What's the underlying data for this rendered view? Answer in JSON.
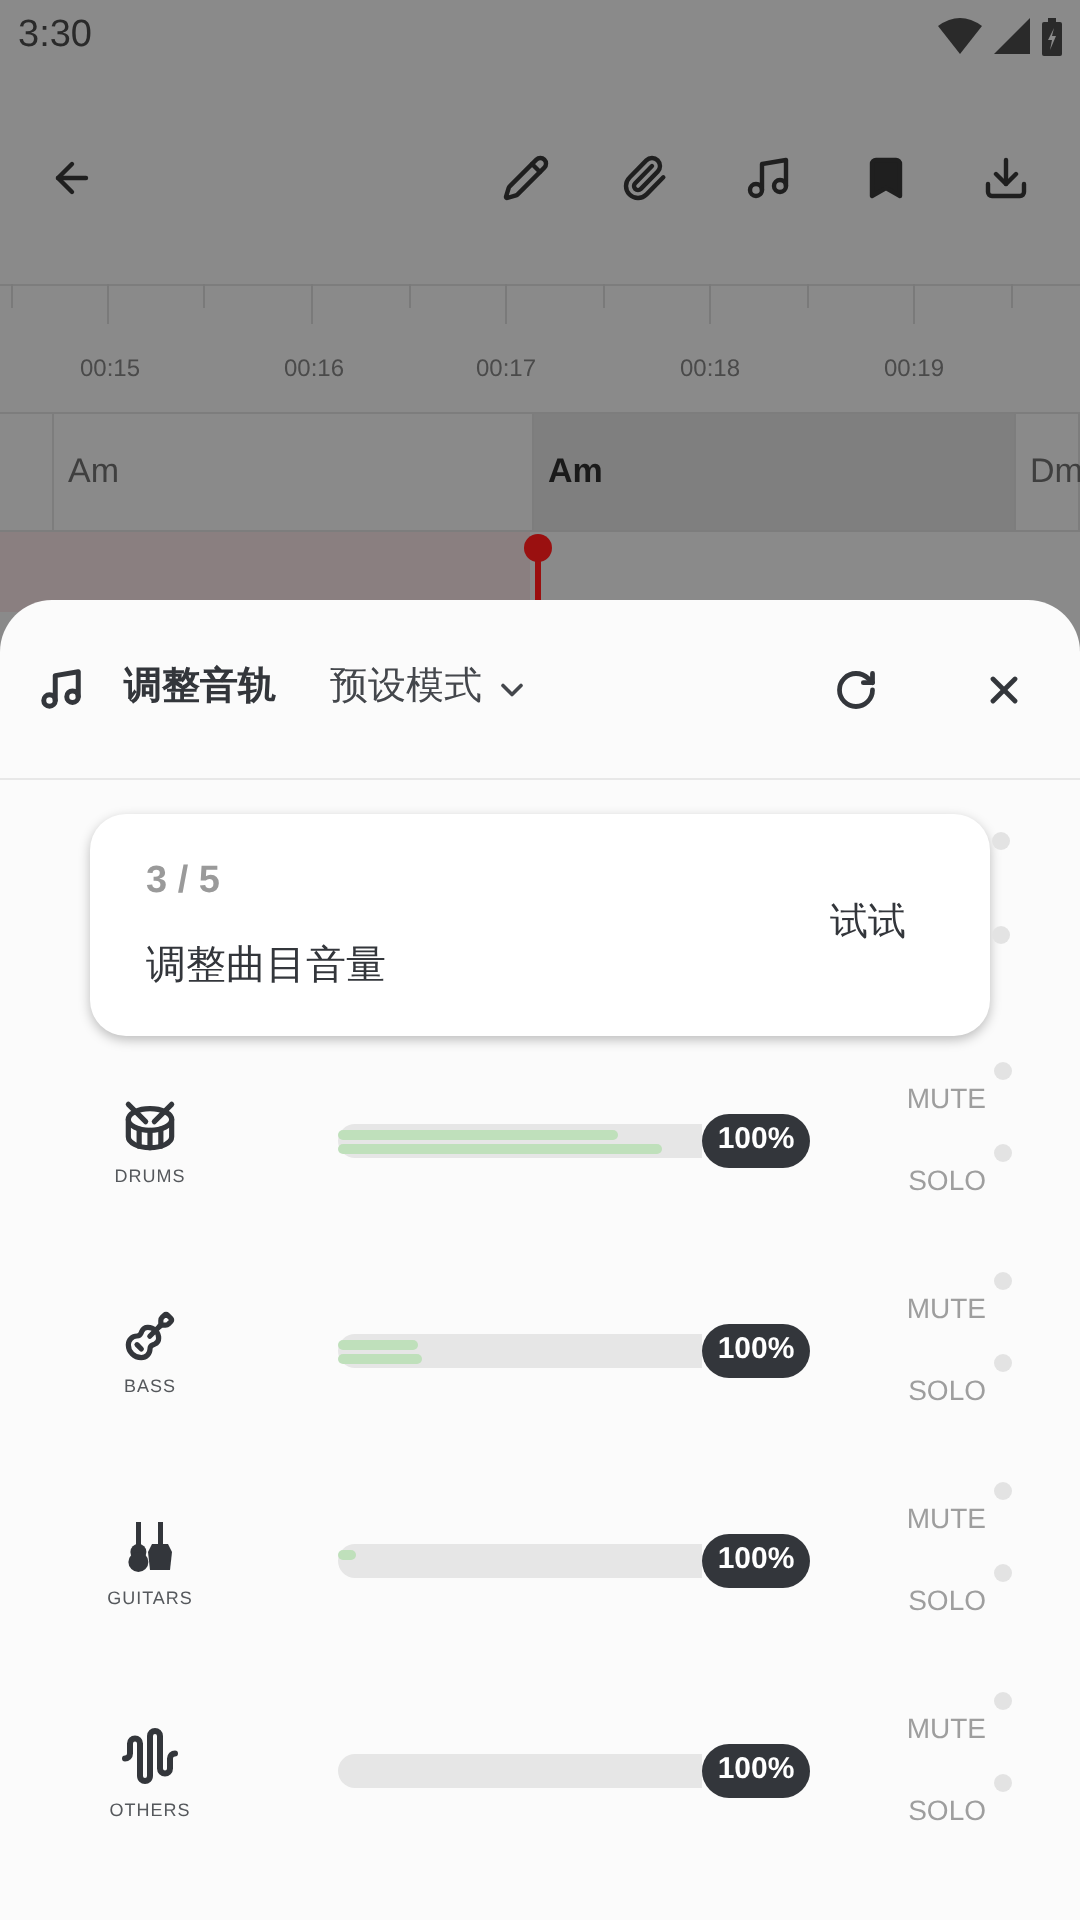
{
  "status_bar": {
    "time": "3:30"
  },
  "timeline": {
    "times": [
      "00:15",
      "00:16",
      "00:17",
      "00:18",
      "00:19"
    ]
  },
  "chords": [
    {
      "label": "Am",
      "selected": false
    },
    {
      "label": "Am",
      "selected": true
    },
    {
      "label": "Dm",
      "selected": false
    }
  ],
  "sheet": {
    "title": "调整音轨",
    "preset": "预设模式",
    "tip": {
      "step": "3 / 5",
      "text": "调整曲目音量",
      "action": "试试"
    },
    "hidden_toggles": [
      {
        "on": false
      },
      {
        "on": false
      }
    ],
    "tracks": [
      {
        "kind": "drums",
        "name": "DRUMS",
        "level": 1,
        "reading": "100%",
        "meters": [
          {
            "level": 0.77
          },
          {
            "level": 0.89
          }
        ],
        "mute": {
          "label": "MUTE",
          "on": false
        },
        "solo": {
          "label": "SOLO",
          "on": false
        }
      },
      {
        "kind": "bass",
        "name": "BASS",
        "level": 1,
        "reading": "100%",
        "meters": [
          {
            "level": 0.22
          },
          {
            "level": 0.23
          }
        ],
        "mute": {
          "label": "MUTE",
          "on": false
        },
        "solo": {
          "label": "SOLO",
          "on": false
        }
      },
      {
        "kind": "guitars",
        "name": "GUITARS",
        "level": 1,
        "reading": "100%",
        "meters": [
          {
            "level": 0.05
          }
        ],
        "mute": {
          "label": "MUTE",
          "on": false
        },
        "solo": {
          "label": "SOLO",
          "on": false
        }
      },
      {
        "kind": "others",
        "name": "OTHERS",
        "level": 1,
        "reading": "100%",
        "mute": {
          "label": "MUTE",
          "on": false
        },
        "solo": {
          "label": "SOLO",
          "on": false
        }
      }
    ]
  }
}
